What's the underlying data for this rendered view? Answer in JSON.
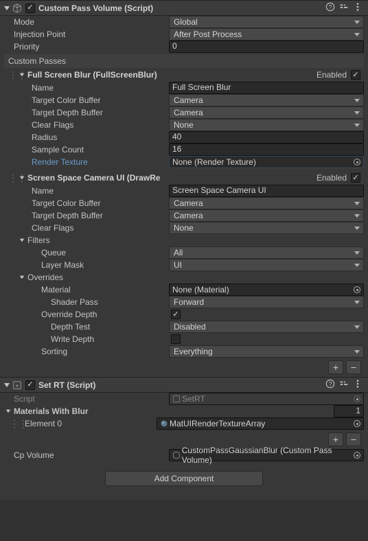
{
  "comp1": {
    "title": "Custom Pass Volume (Script)",
    "mode_label": "Mode",
    "mode_value": "Global",
    "injection_label": "Injection Point",
    "injection_value": "After Post Process",
    "priority_label": "Priority",
    "priority_value": "0",
    "custom_passes_label": "Custom Passes",
    "enabled_label": "Enabled",
    "pass1": {
      "header": "Full Screen Blur (FullScreenBlur)",
      "name_label": "Name",
      "name_value": "Full Screen Blur",
      "tcb_label": "Target Color Buffer",
      "tcb_value": "Camera",
      "tdb_label": "Target Depth Buffer",
      "tdb_value": "Camera",
      "clear_label": "Clear Flags",
      "clear_value": "None",
      "radius_label": "Radius",
      "radius_value": "40",
      "samples_label": "Sample Count",
      "samples_value": "16",
      "rt_label": "Render Texture",
      "rt_value": "None (Render Texture)"
    },
    "pass2": {
      "header": "Screen Space Camera UI (DrawRe",
      "name_label": "Name",
      "name_value": "Screen Space Camera UI",
      "tcb_label": "Target Color Buffer",
      "tcb_value": "Camera",
      "tdb_label": "Target Depth Buffer",
      "tdb_value": "Camera",
      "clear_label": "Clear Flags",
      "clear_value": "None",
      "filters_label": "Filters",
      "queue_label": "Queue",
      "queue_value": "All",
      "layermask_label": "Layer Mask",
      "layermask_value": "UI",
      "overrides_label": "Overrides",
      "material_label": "Material",
      "material_value": "None (Material)",
      "shaderpass_label": "Shader Pass",
      "shaderpass_value": "Forward",
      "overridedepth_label": "Override Depth",
      "depthtest_label": "Depth Test",
      "depthtest_value": "Disabled",
      "writedepth_label": "Write Depth",
      "sorting_label": "Sorting",
      "sorting_value": "Everything"
    }
  },
  "comp2": {
    "title": "Set RT (Script)",
    "script_label": "Script",
    "script_value": "SetRT",
    "materials_label": "Materials With Blur",
    "materials_count": "1",
    "element0_label": "Element 0",
    "element0_value": "MatUIRenderTextureArray",
    "cpvolume_label": "Cp Volume",
    "cpvolume_value": "CustomPassGaussianBlur (Custom Pass Volume)"
  },
  "add_component": "Add Component"
}
